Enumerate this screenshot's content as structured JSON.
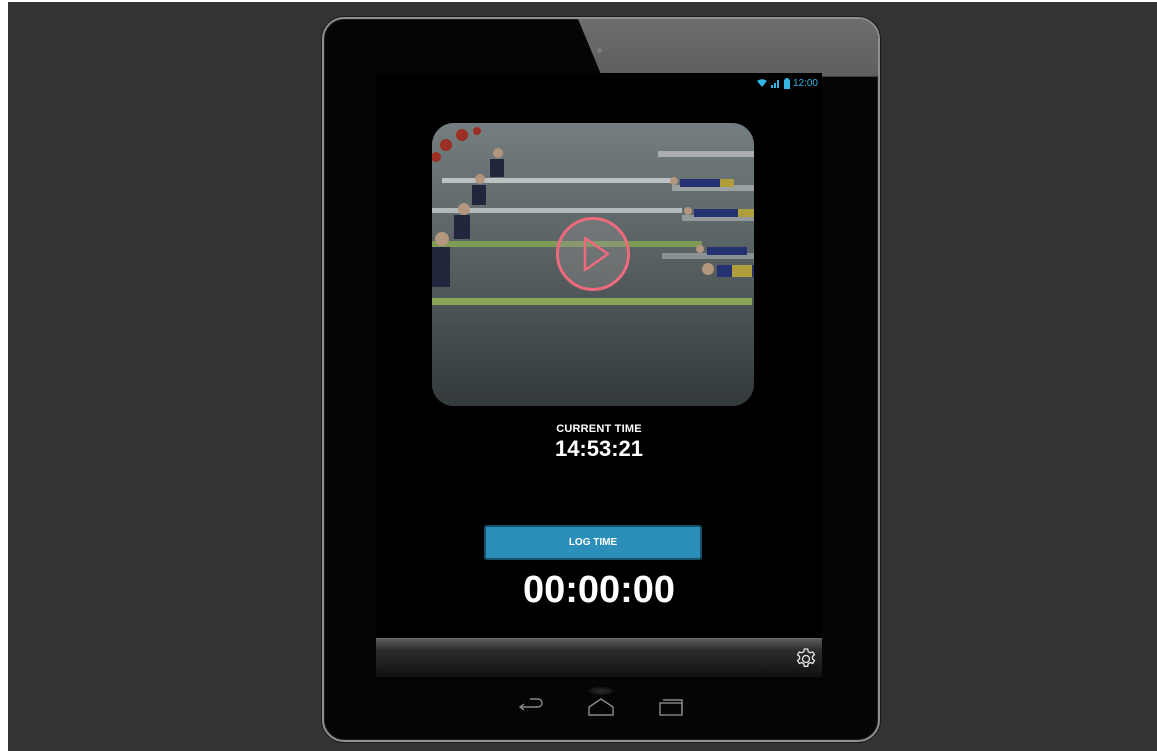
{
  "device": {
    "type": "tablet",
    "frame_color": "#050505",
    "bezel_edge_color": "#8f8f8f"
  },
  "status_bar": {
    "clock": "12:00",
    "accent_color": "#33b5e5",
    "icons": [
      "wifi-icon",
      "signal-icon",
      "battery-icon"
    ]
  },
  "video": {
    "thumbnail": "rowing-race-start",
    "play_icon": "play-icon",
    "play_ring_color": "#ef6a7c"
  },
  "clock": {
    "label": "CURRENT TIME",
    "value": "14:53:21"
  },
  "log_button": {
    "label": "LOG TIME",
    "color": "#2b8fba"
  },
  "timer": {
    "value": "00:00:00"
  },
  "toolbar": {
    "settings_icon": "gear-icon"
  },
  "nav_bar": {
    "buttons": [
      "back-icon",
      "home-icon",
      "recent-apps-icon"
    ]
  }
}
